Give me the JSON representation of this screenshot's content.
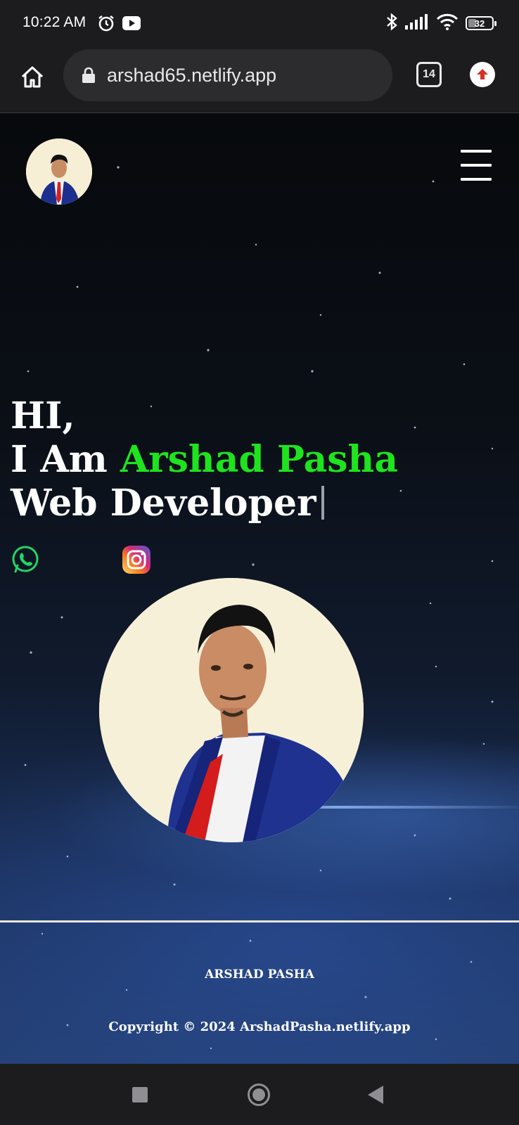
{
  "status_bar": {
    "time": "10:22 AM",
    "battery_level": "32",
    "icons": [
      "alarm-icon",
      "youtube-icon",
      "bluetooth-icon",
      "signal-icon",
      "wifi-icon",
      "battery-icon"
    ]
  },
  "browser": {
    "url": "arshad65.netlify.app",
    "tab_count": "14",
    "icons": [
      "home-icon",
      "lock-icon",
      "tabs-icon",
      "update-icon"
    ]
  },
  "page": {
    "hero": {
      "greeting": "HI,",
      "intro": "I Am ",
      "name": "Arshad Pasha",
      "role": "Web Developer"
    },
    "social": [
      "whatsapp-icon",
      "instagram-icon"
    ],
    "footer": {
      "name": "ARSHAD PASHA",
      "copyright": "Copyright © 2024 ArshadPasha.netlify.app"
    }
  },
  "colors": {
    "accent_name": "#1fe31f",
    "browser_bg": "#1c1c1e",
    "urlbar_bg": "#2c2c2e"
  }
}
